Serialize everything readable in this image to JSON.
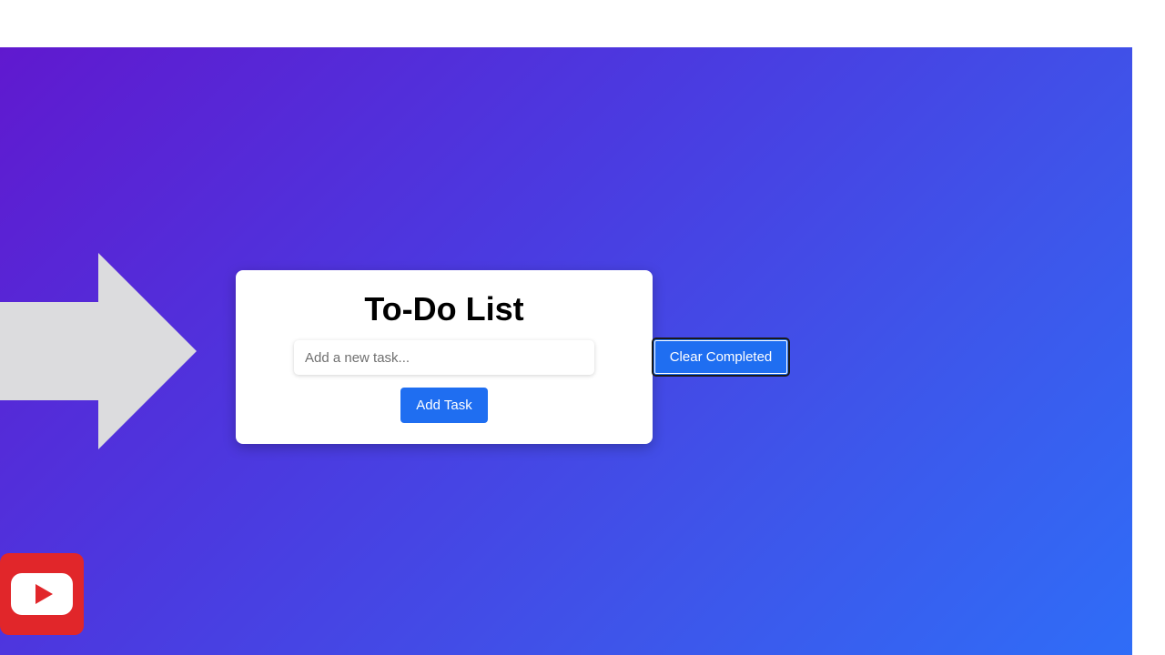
{
  "colors": {
    "gradient_start": "#6019cf",
    "gradient_end": "#2f6df7",
    "button_blue": "#1f6ef1",
    "arrow_gray": "#dcdcde",
    "youtube_red": "#e1262a"
  },
  "decorations": {
    "arrow_icon": "arrow-right-icon",
    "logo_icon": "youtube-icon"
  },
  "todo": {
    "title": "To-Do List",
    "input_placeholder": "Add a new task...",
    "input_value": "",
    "add_button_label": "Add Task",
    "clear_button_label": "Clear Completed"
  }
}
